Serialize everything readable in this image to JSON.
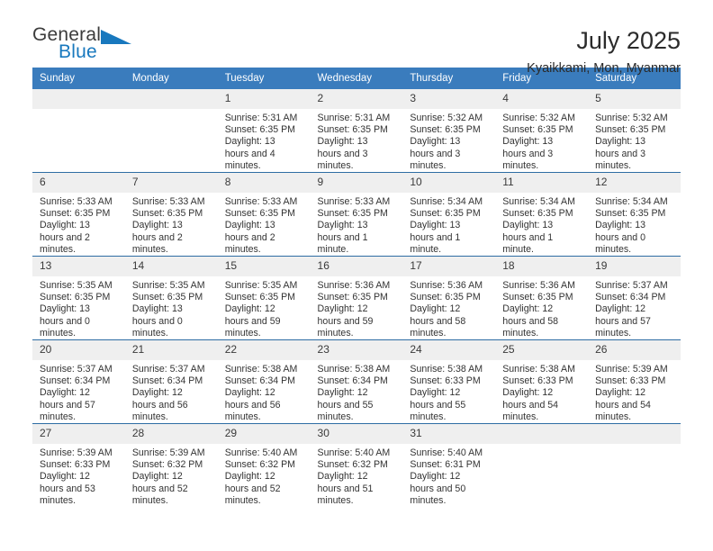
{
  "logo": {
    "part1": "General",
    "part2": "Blue",
    "icon": "triangle-mark",
    "color_primary": "#1878be",
    "color_text": "#3c3c3c"
  },
  "header": {
    "title": "July 2025",
    "subtitle": "Kyaikkami, Mon, Myanmar",
    "band_color": "#3a7cbd",
    "rule_color": "#2e6da4"
  },
  "weekdays": [
    "Sunday",
    "Monday",
    "Tuesday",
    "Wednesday",
    "Thursday",
    "Friday",
    "Saturday"
  ],
  "labels": {
    "sunrise": "Sunrise:",
    "sunset": "Sunset:",
    "daylight": "Daylight:"
  },
  "weeks": [
    [
      {
        "day": "",
        "empty": true
      },
      {
        "day": "",
        "empty": true
      },
      {
        "day": "1",
        "sunrise": "Sunrise: 5:31 AM",
        "sunset": "Sunset: 6:35 PM",
        "daylight": "Daylight: 13 hours and 4 minutes."
      },
      {
        "day": "2",
        "sunrise": "Sunrise: 5:31 AM",
        "sunset": "Sunset: 6:35 PM",
        "daylight": "Daylight: 13 hours and 3 minutes."
      },
      {
        "day": "3",
        "sunrise": "Sunrise: 5:32 AM",
        "sunset": "Sunset: 6:35 PM",
        "daylight": "Daylight: 13 hours and 3 minutes."
      },
      {
        "day": "4",
        "sunrise": "Sunrise: 5:32 AM",
        "sunset": "Sunset: 6:35 PM",
        "daylight": "Daylight: 13 hours and 3 minutes."
      },
      {
        "day": "5",
        "sunrise": "Sunrise: 5:32 AM",
        "sunset": "Sunset: 6:35 PM",
        "daylight": "Daylight: 13 hours and 3 minutes."
      }
    ],
    [
      {
        "day": "6",
        "sunrise": "Sunrise: 5:33 AM",
        "sunset": "Sunset: 6:35 PM",
        "daylight": "Daylight: 13 hours and 2 minutes."
      },
      {
        "day": "7",
        "sunrise": "Sunrise: 5:33 AM",
        "sunset": "Sunset: 6:35 PM",
        "daylight": "Daylight: 13 hours and 2 minutes."
      },
      {
        "day": "8",
        "sunrise": "Sunrise: 5:33 AM",
        "sunset": "Sunset: 6:35 PM",
        "daylight": "Daylight: 13 hours and 2 minutes."
      },
      {
        "day": "9",
        "sunrise": "Sunrise: 5:33 AM",
        "sunset": "Sunset: 6:35 PM",
        "daylight": "Daylight: 13 hours and 1 minute."
      },
      {
        "day": "10",
        "sunrise": "Sunrise: 5:34 AM",
        "sunset": "Sunset: 6:35 PM",
        "daylight": "Daylight: 13 hours and 1 minute."
      },
      {
        "day": "11",
        "sunrise": "Sunrise: 5:34 AM",
        "sunset": "Sunset: 6:35 PM",
        "daylight": "Daylight: 13 hours and 1 minute."
      },
      {
        "day": "12",
        "sunrise": "Sunrise: 5:34 AM",
        "sunset": "Sunset: 6:35 PM",
        "daylight": "Daylight: 13 hours and 0 minutes."
      }
    ],
    [
      {
        "day": "13",
        "sunrise": "Sunrise: 5:35 AM",
        "sunset": "Sunset: 6:35 PM",
        "daylight": "Daylight: 13 hours and 0 minutes."
      },
      {
        "day": "14",
        "sunrise": "Sunrise: 5:35 AM",
        "sunset": "Sunset: 6:35 PM",
        "daylight": "Daylight: 13 hours and 0 minutes."
      },
      {
        "day": "15",
        "sunrise": "Sunrise: 5:35 AM",
        "sunset": "Sunset: 6:35 PM",
        "daylight": "Daylight: 12 hours and 59 minutes."
      },
      {
        "day": "16",
        "sunrise": "Sunrise: 5:36 AM",
        "sunset": "Sunset: 6:35 PM",
        "daylight": "Daylight: 12 hours and 59 minutes."
      },
      {
        "day": "17",
        "sunrise": "Sunrise: 5:36 AM",
        "sunset": "Sunset: 6:35 PM",
        "daylight": "Daylight: 12 hours and 58 minutes."
      },
      {
        "day": "18",
        "sunrise": "Sunrise: 5:36 AM",
        "sunset": "Sunset: 6:35 PM",
        "daylight": "Daylight: 12 hours and 58 minutes."
      },
      {
        "day": "19",
        "sunrise": "Sunrise: 5:37 AM",
        "sunset": "Sunset: 6:34 PM",
        "daylight": "Daylight: 12 hours and 57 minutes."
      }
    ],
    [
      {
        "day": "20",
        "sunrise": "Sunrise: 5:37 AM",
        "sunset": "Sunset: 6:34 PM",
        "daylight": "Daylight: 12 hours and 57 minutes."
      },
      {
        "day": "21",
        "sunrise": "Sunrise: 5:37 AM",
        "sunset": "Sunset: 6:34 PM",
        "daylight": "Daylight: 12 hours and 56 minutes."
      },
      {
        "day": "22",
        "sunrise": "Sunrise: 5:38 AM",
        "sunset": "Sunset: 6:34 PM",
        "daylight": "Daylight: 12 hours and 56 minutes."
      },
      {
        "day": "23",
        "sunrise": "Sunrise: 5:38 AM",
        "sunset": "Sunset: 6:34 PM",
        "daylight": "Daylight: 12 hours and 55 minutes."
      },
      {
        "day": "24",
        "sunrise": "Sunrise: 5:38 AM",
        "sunset": "Sunset: 6:33 PM",
        "daylight": "Daylight: 12 hours and 55 minutes."
      },
      {
        "day": "25",
        "sunrise": "Sunrise: 5:38 AM",
        "sunset": "Sunset: 6:33 PM",
        "daylight": "Daylight: 12 hours and 54 minutes."
      },
      {
        "day": "26",
        "sunrise": "Sunrise: 5:39 AM",
        "sunset": "Sunset: 6:33 PM",
        "daylight": "Daylight: 12 hours and 54 minutes."
      }
    ],
    [
      {
        "day": "27",
        "sunrise": "Sunrise: 5:39 AM",
        "sunset": "Sunset: 6:33 PM",
        "daylight": "Daylight: 12 hours and 53 minutes."
      },
      {
        "day": "28",
        "sunrise": "Sunrise: 5:39 AM",
        "sunset": "Sunset: 6:32 PM",
        "daylight": "Daylight: 12 hours and 52 minutes."
      },
      {
        "day": "29",
        "sunrise": "Sunrise: 5:40 AM",
        "sunset": "Sunset: 6:32 PM",
        "daylight": "Daylight: 12 hours and 52 minutes."
      },
      {
        "day": "30",
        "sunrise": "Sunrise: 5:40 AM",
        "sunset": "Sunset: 6:32 PM",
        "daylight": "Daylight: 12 hours and 51 minutes."
      },
      {
        "day": "31",
        "sunrise": "Sunrise: 5:40 AM",
        "sunset": "Sunset: 6:31 PM",
        "daylight": "Daylight: 12 hours and 50 minutes."
      },
      {
        "day": "",
        "empty": true
      },
      {
        "day": "",
        "empty": true
      }
    ]
  ]
}
